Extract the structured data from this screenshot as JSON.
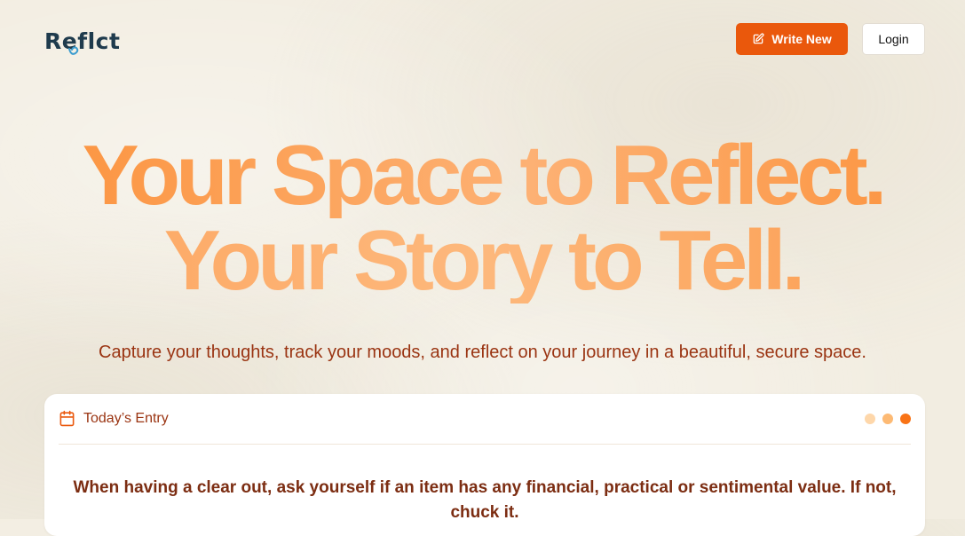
{
  "brand": {
    "logo_text": "Reflct",
    "logo_color": "#1f3b4d",
    "swirl_color": "#3b9ccf"
  },
  "header": {
    "write_new_label": "Write New",
    "write_new_icon": "edit-icon",
    "login_label": "Login"
  },
  "hero": {
    "title_line1": "Your Space to Reflect.",
    "title_line2": "Your Story to Tell.",
    "subtitle": "Capture your thoughts, track your moods, and reflect on your journey in a beautiful, secure space."
  },
  "entry_card": {
    "title": "Today’s Entry",
    "icon": "calendar-icon",
    "dot_colors": [
      "#fed7aa",
      "#fdba74",
      "#f97316"
    ],
    "quote": "When having a clear out, ask yourself if an item has any financial, practical or sentimental value. If not, chuck it."
  },
  "colors": {
    "accent": "#ea580c",
    "text_brown": "#9a3412",
    "quote_brown": "#7c2d12"
  }
}
